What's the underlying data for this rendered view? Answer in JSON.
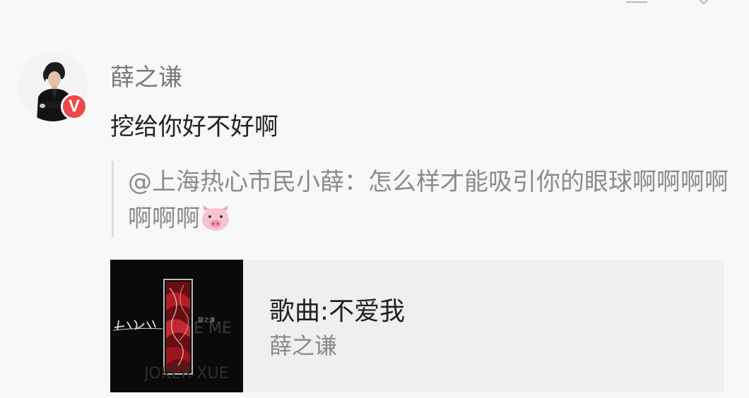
{
  "comment": {
    "user": {
      "name": "薛之谦",
      "avatar_icon": "celebrity-avatar",
      "badge_label": "V",
      "badge_color": "#f04848"
    },
    "text": "挖给你好不好啊",
    "quoted": {
      "text": "@上海热心市民小薛：怎么样才能吸引你的眼球啊啊啊啊啊啊啊",
      "emoji_icon": "pig-face-icon"
    },
    "music_card": {
      "title": "歌曲:不爱我",
      "artist": "薛之谦",
      "cover_icon": "album-cover-image"
    }
  },
  "top_bar": {
    "icons": [
      "menu-icon",
      "chevron-down-icon"
    ]
  }
}
